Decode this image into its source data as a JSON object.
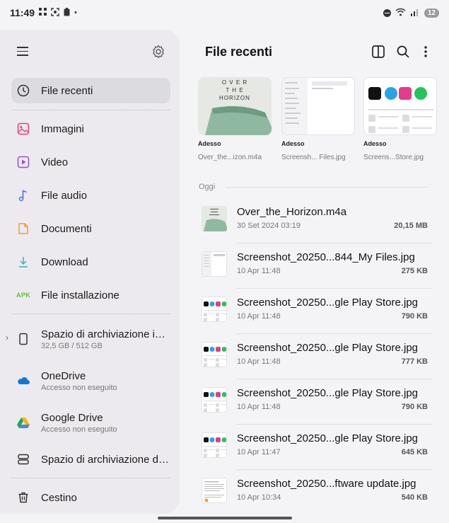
{
  "status_bar": {
    "time": "11:49",
    "left_icons": [
      "grid-icon",
      "screenshot-icon",
      "battery-icon"
    ],
    "dot": "•",
    "battery_level": "12"
  },
  "sidebar": {
    "items": [
      {
        "label": "File recenti",
        "icon": "clock-icon",
        "active": true
      },
      {
        "label": "Immagini",
        "icon": "image-icon",
        "color": "#e0457b"
      },
      {
        "label": "Video",
        "icon": "video-icon",
        "color": "#9b4dd6"
      },
      {
        "label": "File audio",
        "icon": "music-icon",
        "color": "#4a6fe0"
      },
      {
        "label": "Documenti",
        "icon": "document-icon",
        "color": "#f0a030"
      },
      {
        "label": "Download",
        "icon": "download-icon",
        "color": "#2fb8a8"
      },
      {
        "label": "File installazione",
        "icon": "apk-icon",
        "badge": "APK"
      }
    ],
    "storage": [
      {
        "label": "Spazio di archiviazione interna",
        "sub": "32,5 GB / 512 GB",
        "icon": "phone-icon"
      },
      {
        "label": "OneDrive",
        "sub": "Accesso non eseguito",
        "icon": "onedrive-icon"
      },
      {
        "label": "Google Drive",
        "sub": "Accesso non eseguito",
        "icon": "google-drive-icon"
      },
      {
        "label": "Spazio di archiviazione di rete",
        "icon": "network-storage-icon"
      }
    ],
    "trash": {
      "label": "Cestino",
      "icon": "trash-icon"
    }
  },
  "main": {
    "title": "File recenti",
    "thumbs": [
      {
        "when": "Adesso",
        "name": "Over_the...izon.m4a",
        "cover_text": [
          "O V E R",
          "T H E",
          "HORIZON"
        ]
      },
      {
        "when": "Adesso",
        "name": "Screensh... Files.jpg"
      },
      {
        "when": "Adesso",
        "name": "Screens...Store.jpg"
      }
    ],
    "section": "Oggi",
    "files": [
      {
        "name": "Over_the_Horizon.m4a",
        "date": "30 Set 2024 03:19",
        "size": "20,15 MB",
        "kind": "audio"
      },
      {
        "name": "Screenshot_20250...844_My Files.jpg",
        "date": "10 Apr 11:48",
        "size": "275 KB",
        "kind": "files"
      },
      {
        "name": "Screenshot_20250...gle Play Store.jpg",
        "date": "10 Apr 11:48",
        "size": "790 KB",
        "kind": "store"
      },
      {
        "name": "Screenshot_20250...gle Play Store.jpg",
        "date": "10 Apr 11:48",
        "size": "777 KB",
        "kind": "store"
      },
      {
        "name": "Screenshot_20250...gle Play Store.jpg",
        "date": "10 Apr 11:48",
        "size": "790 KB",
        "kind": "store"
      },
      {
        "name": "Screenshot_20250...gle Play Store.jpg",
        "date": "10 Apr 11:47",
        "size": "645 KB",
        "kind": "store"
      },
      {
        "name": "Screenshot_20250...ftware update.jpg",
        "date": "10 Apr 10:34",
        "size": "540 KB",
        "kind": "doc"
      }
    ]
  },
  "colors": {
    "accent_green": "#5cbf3a",
    "sidebar_bg": "#eceaee",
    "active_bg": "#dcdbe0"
  }
}
